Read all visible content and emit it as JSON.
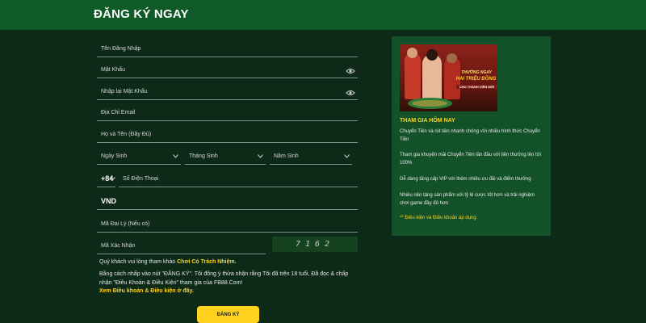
{
  "header": {
    "title": "ĐĂNG KÝ NGAY"
  },
  "form": {
    "username_placeholder": "Tên Đăng Nhập",
    "password_placeholder": "Mật Khẩu",
    "confirm_password_placeholder": "Nhập lại Mật Khẩu",
    "email_placeholder": "Địa Chỉ Email",
    "fullname_placeholder": "Họ và Tên (Đầy Đủ)",
    "birth_day_placeholder": "Ngày Sinh",
    "birth_month_placeholder": "Tháng Sinh",
    "birth_year_placeholder": "Năm Sinh",
    "phone_code": "+84",
    "phone_placeholder": "Số Điện Thoại",
    "currency_value": "VND",
    "agent_code_placeholder": "Mã Đại Lý (Nếu có)",
    "captcha_placeholder": "Mã Xác Nhận",
    "captcha_code": "7162",
    "responsibility_prefix": "Quý khách vui lòng tham khảo ",
    "responsibility_link": "Chơi Có Trách Nhiệm.",
    "terms_text": "Bằng cách nhấp vào nút \"ĐĂNG KÝ\". Tôi đồng ý thừa nhận rằng Tôi đã trên 18 tuổi, Đã đọc & chấp nhận \"Điều Khoản & Điều Kiện\" tham gia của FB88.Com!",
    "terms_link": "Xem Điều khoản & Điều kiện ở đây.",
    "submit_label": "ĐĂNG KÝ"
  },
  "promo": {
    "banner": {
      "line1": "THƯỞNG NGAY",
      "line2": "HAI TRIỆU ĐỒNG",
      "line3": "CHO THÀNH VIÊN MỚI"
    },
    "title": "THAM GIA HÔM NAY",
    "items": [
      "Chuyển Tiền và rút tiền nhanh chóng với nhiều hình thức Chuyển Tiền",
      "Tham gia khuyến mãi Chuyển Tiền lần đầu với tiền thưởng lên tới 100%",
      "Dễ dàng tăng cấp VIP với thêm nhiều ưu đãi và điểm thưởng",
      "Nhiều nền tảng sản phẩm với tỷ lệ cược tốt hơn và trải nghiệm chơi game đầy đủ hơn"
    ],
    "footer_link": "** Điều kiện và Điều khoản áp dụng"
  },
  "colors": {
    "accent": "#ffd21f",
    "background": "#0c2a17",
    "header": "#0f5a27",
    "panel": "#135229"
  },
  "icons": {
    "password_toggle": "eye-icon",
    "select": "chevron-down-icon"
  }
}
